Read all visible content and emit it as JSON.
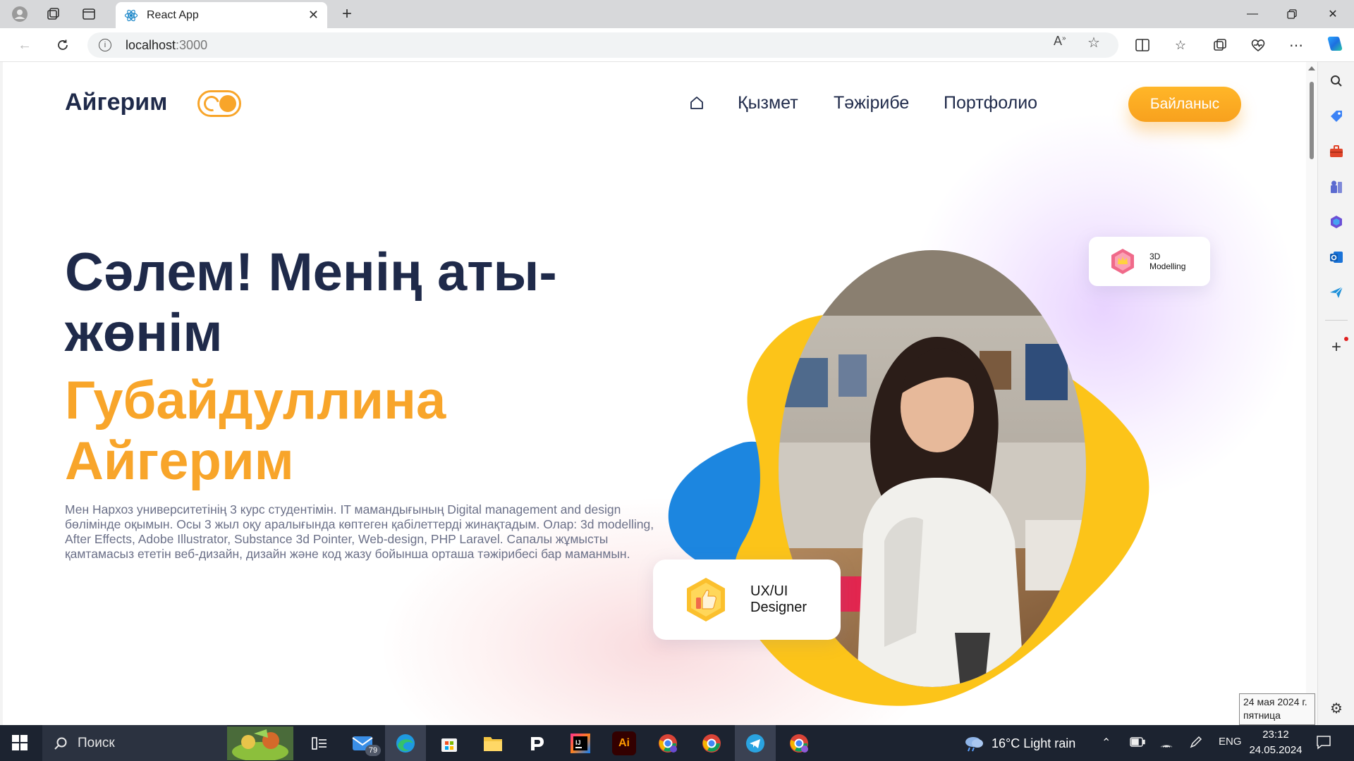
{
  "browser": {
    "tab_title": "React App",
    "url_host": "localhost",
    "url_port": ":3000",
    "omnibox_read_aloud": "A",
    "omnibox_read_aloud_sup": "»"
  },
  "site": {
    "logo": "Айгерим",
    "nav": {
      "home_icon": "home-icon",
      "links": [
        "Қызмет",
        "Тәжірибе",
        "Портфолио"
      ],
      "contact": "Байланыс"
    },
    "hero": {
      "greeting": "Сәлем! Менің аты-жөнім",
      "name": "Губайдуллина Айгерим",
      "bio": "Мен Нархоз университетінің 3 курс студентімін. IT мамандығының Digital management and design бөлімінде оқымын. Осы 3 жыл оқу аралығында көптеген қабілеттерді жинақтадым. Олар: 3d modelling, After Effects, Adobe Illustrator, Substance 3d Pointer, Web-design, PHP Laravel. Сапалы жұмысты қамтамасыз ететін веб-дизайн, дизайн және код жазу бойынша орташа тәжірибесі бар маманмын."
    },
    "cards": {
      "modelling_line1": "3D",
      "modelling_line2": "Modelling",
      "ux_line1": "UX/UI",
      "ux_line2": "Designer"
    },
    "colors": {
      "navy": "#1f2a4a",
      "orange": "#f8a52a",
      "yellow": "#fcc419",
      "blue": "#1c86e0"
    }
  },
  "taskbar": {
    "search_placeholder": "Поиск",
    "mail_badge": "79",
    "weather": "16°C  Light rain",
    "lang": "ENG",
    "time": "23:12",
    "date": "24.05.2024",
    "tooltip_line1": "24 мая 2024 г.",
    "tooltip_line2": "пятница"
  }
}
